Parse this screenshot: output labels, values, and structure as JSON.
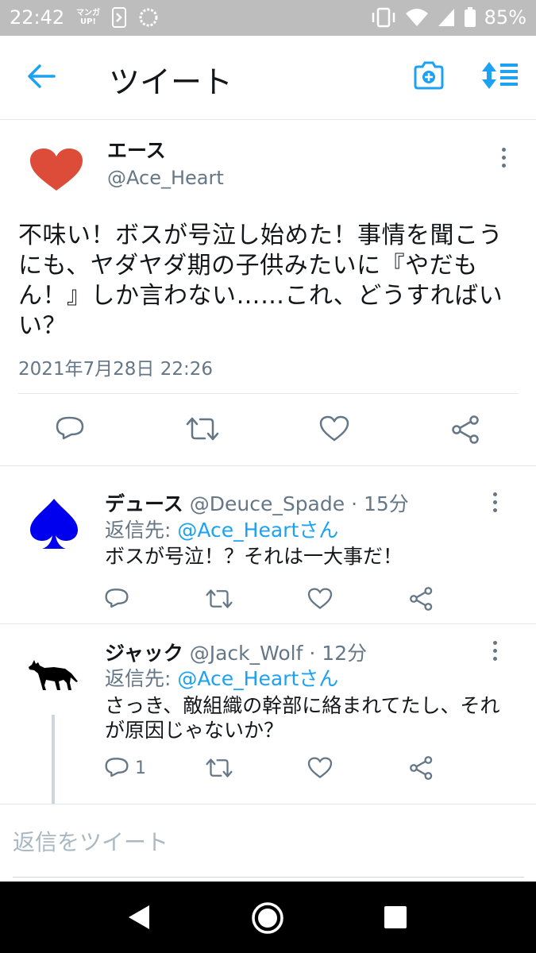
{
  "status_bar": {
    "time": "22:42",
    "manga_app_label": "マンガ UP!",
    "battery_percent": "85%"
  },
  "header": {
    "title": "ツイート"
  },
  "main_tweet": {
    "name": "エース",
    "handle": "@Ace_Heart",
    "text": "不味い！ボスが号泣し始めた！事情を聞こうにも、ヤダヤダ期の子供みたいに『やだもん！』しか言わない……これ、どうすればいい？",
    "date": "2021年7月28日 22:26"
  },
  "replies": [
    {
      "name": "デュース",
      "handle": "@Deuce_Spade",
      "time": "15分",
      "reply_to_label": "返信先: ",
      "reply_to_user": "@Ace_Heartさん",
      "text": "ボスが号泣！？それは一大事だ！",
      "reply_count": ""
    },
    {
      "name": "ジャック",
      "handle": "@Jack_Wolf",
      "time": "12分",
      "reply_to_label": "返信先: ",
      "reply_to_user": "@Ace_Heartさん",
      "text": "さっき、敵組織の幹部に絡まれてたし、それが原因じゃないか？",
      "reply_count": "1"
    }
  ],
  "compose": {
    "placeholder": "返信をツイート"
  },
  "colors": {
    "accent": "#1da1f2",
    "heart": "#dd4b39",
    "spade": "#0000ee",
    "status_bar": "#bdbdbd",
    "nav_bar": "#000000"
  },
  "icons": [
    "back-arrow-icon",
    "camera-add-icon",
    "sort-icon",
    "reply-icon",
    "retweet-icon",
    "like-icon",
    "share-icon",
    "more-icon",
    "back-nav-icon",
    "home-nav-icon",
    "recents-nav-icon"
  ]
}
